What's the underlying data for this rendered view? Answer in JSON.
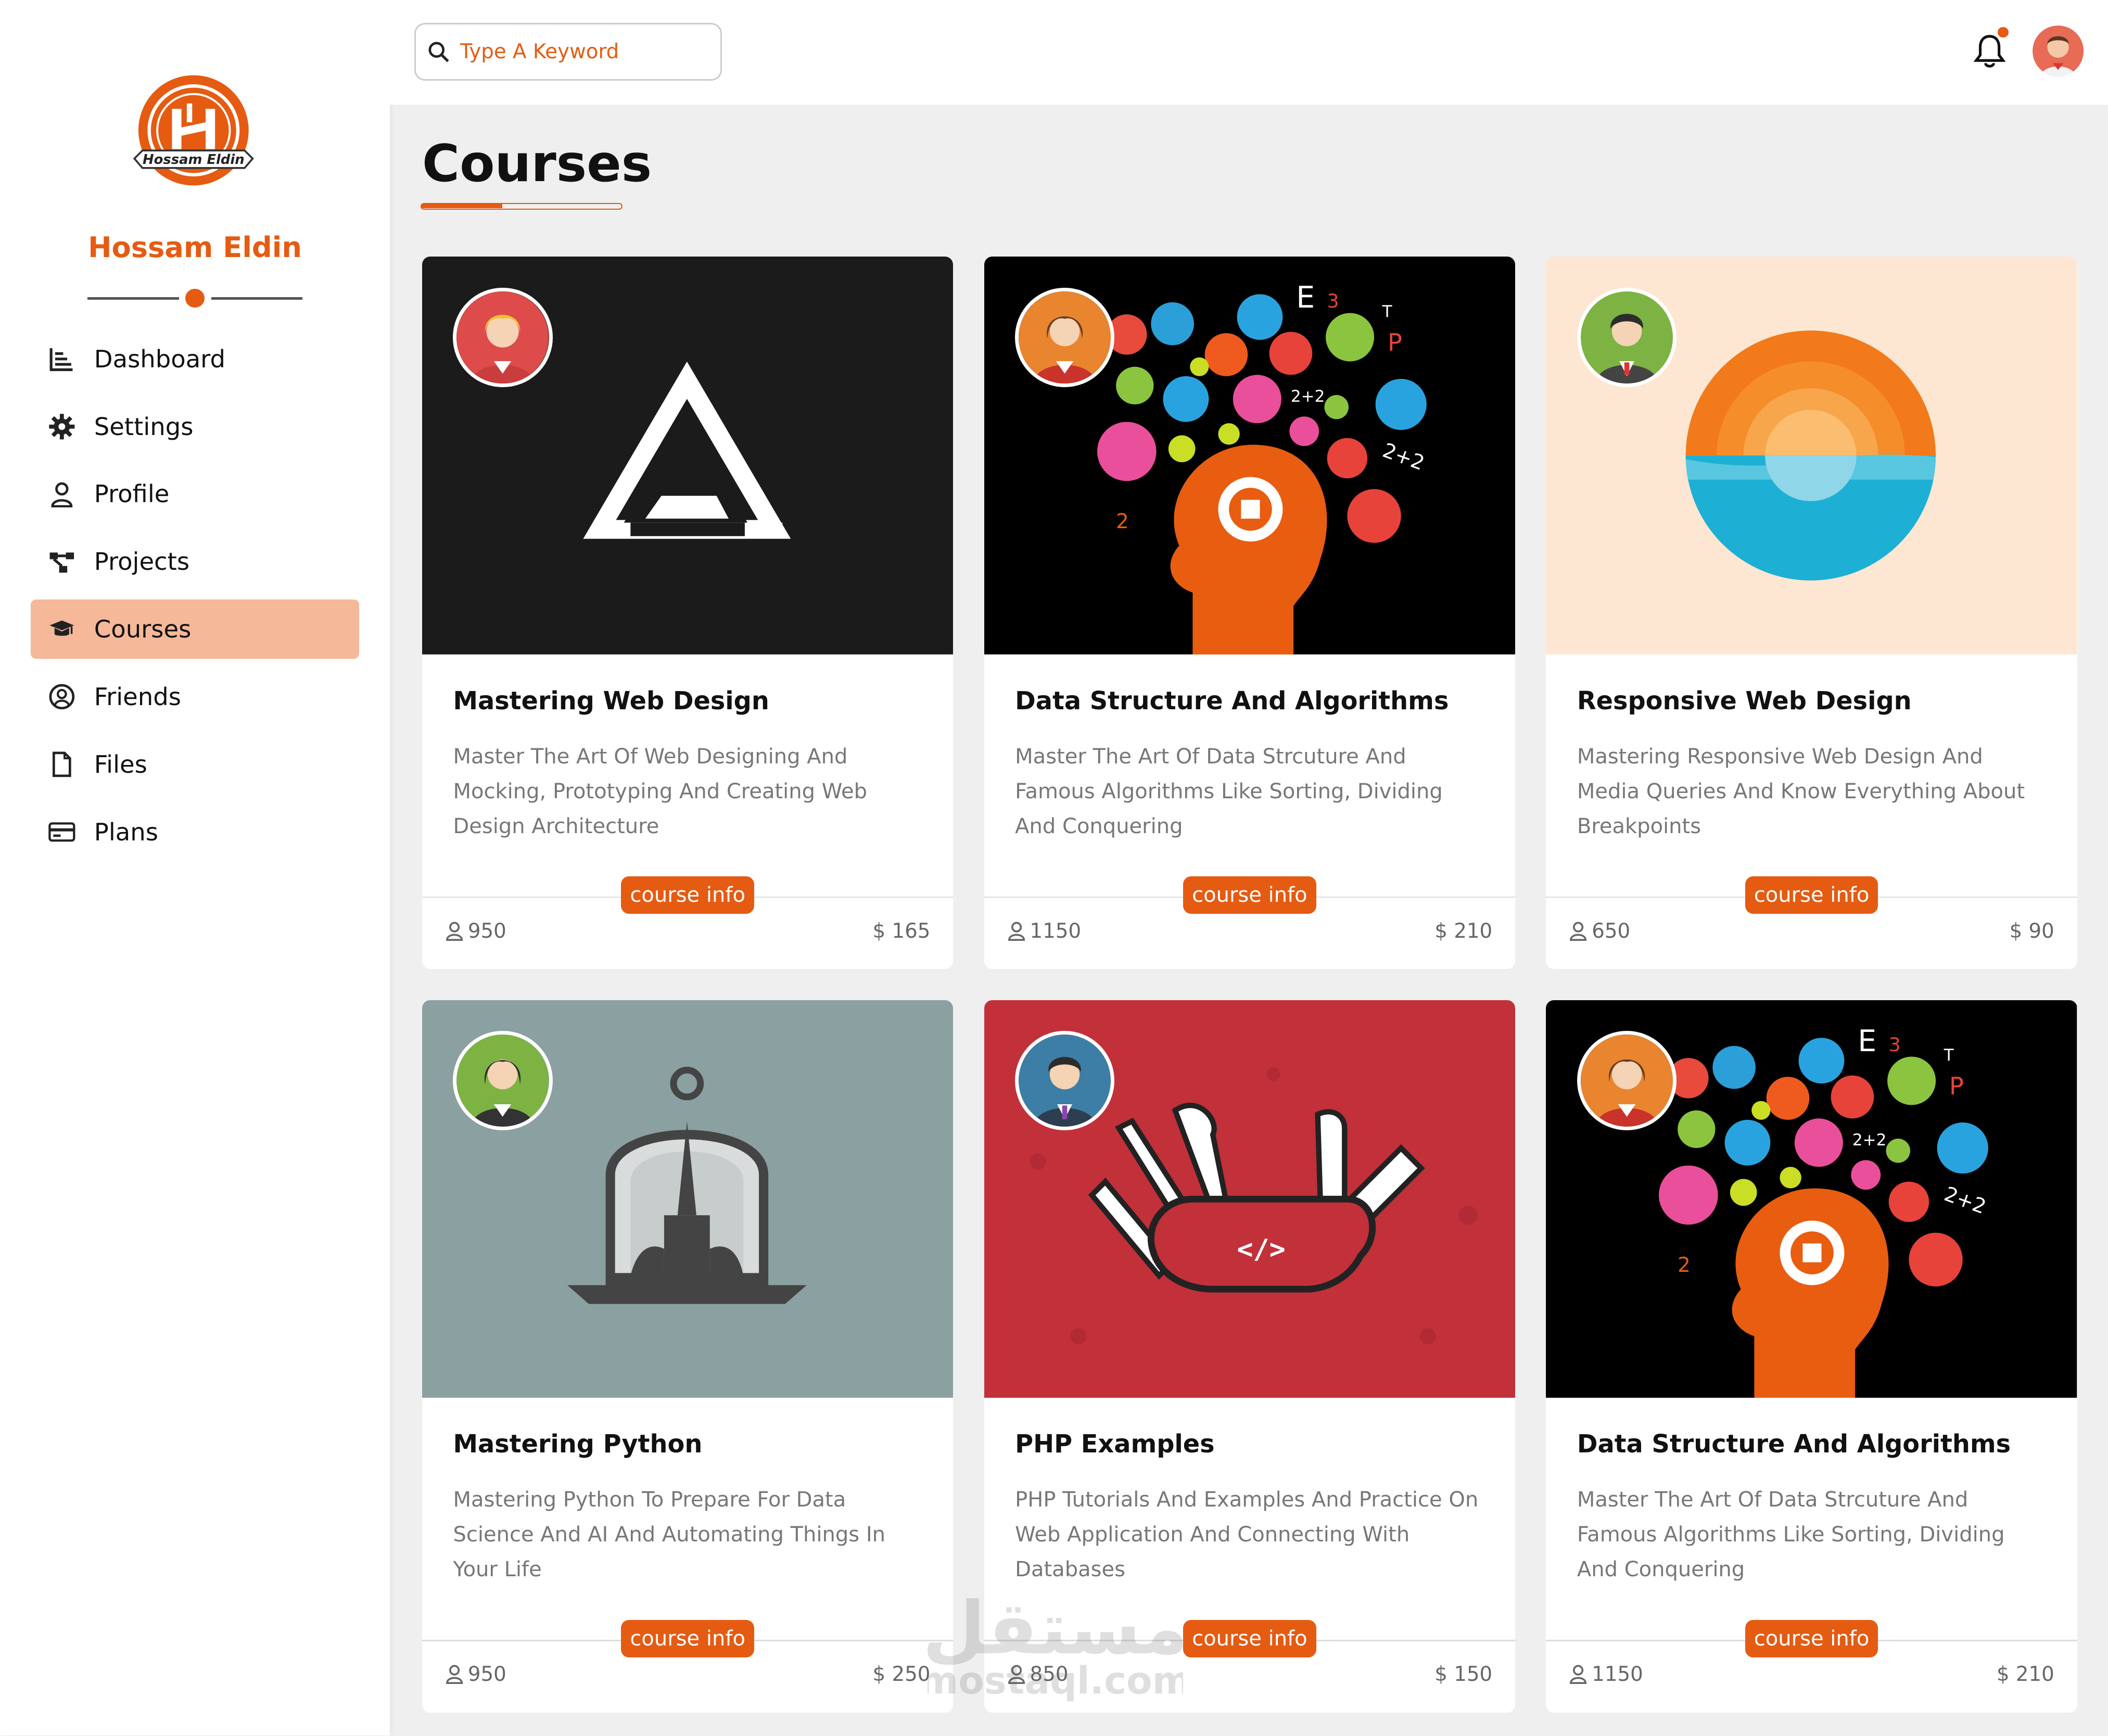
{
  "sidebar": {
    "brand": "Hossam Eldin",
    "logo_text": "Hossam Eldin",
    "items": [
      {
        "label": "Dashboard",
        "icon": "bar-chart-icon",
        "active": false
      },
      {
        "label": "Settings",
        "icon": "gear-icon",
        "active": false
      },
      {
        "label": "Profile",
        "icon": "user-icon",
        "active": false
      },
      {
        "label": "Projects",
        "icon": "project-diagram-icon",
        "active": false
      },
      {
        "label": "Courses",
        "icon": "graduation-cap-icon",
        "active": true
      },
      {
        "label": "Friends",
        "icon": "user-circle-icon",
        "active": false
      },
      {
        "label": "Files",
        "icon": "file-icon",
        "active": false
      },
      {
        "label": "Plans",
        "icon": "credit-card-icon",
        "active": false
      }
    ]
  },
  "header": {
    "search_placeholder": "Type A Keyword",
    "notification_icon": "bell-icon",
    "has_notification": true
  },
  "main": {
    "title": "Courses",
    "courses": [
      {
        "title": "Mastering Web Design",
        "description": "Master The Art Of Web Designing And Mocking, Prototyping And Creating Web Design Architecture",
        "button": "course info",
        "students": "950",
        "price": "$ 165"
      },
      {
        "title": "Data Structure And Algorithms",
        "description": "Master The Art Of Data Strcuture And Famous Algorithms Like Sorting, Dividing And Conquering",
        "button": "course info",
        "students": "1150",
        "price": "$ 210"
      },
      {
        "title": "Responsive Web Design",
        "description": "Mastering Responsive Web Design And Media Queries And Know Everything About Breakpoints",
        "button": "course info",
        "students": "650",
        "price": "$ 90"
      },
      {
        "title": "Mastering Python",
        "description": "Mastering Python To Prepare For Data Science And AI And Automating Things In Your Life",
        "button": "course info",
        "students": "950",
        "price": "$ 250"
      },
      {
        "title": "PHP Examples",
        "description": "PHP Tutorials And Examples And Practice On Web Application And Connecting With Databases",
        "button": "course info",
        "students": "850",
        "price": "$ 150"
      },
      {
        "title": "Data Structure And Algorithms",
        "description": "Master The Art Of Data Strcuture And Famous Algorithms Like Sorting, Dividing And Conquering",
        "button": "course info",
        "students": "1150",
        "price": "$ 210"
      }
    ]
  },
  "watermark": {
    "arabic": "مستقل",
    "latin": "mostaql.com"
  },
  "colors": {
    "accent": "#e55b12",
    "active_nav": "#f5b899",
    "background": "#efefef"
  }
}
